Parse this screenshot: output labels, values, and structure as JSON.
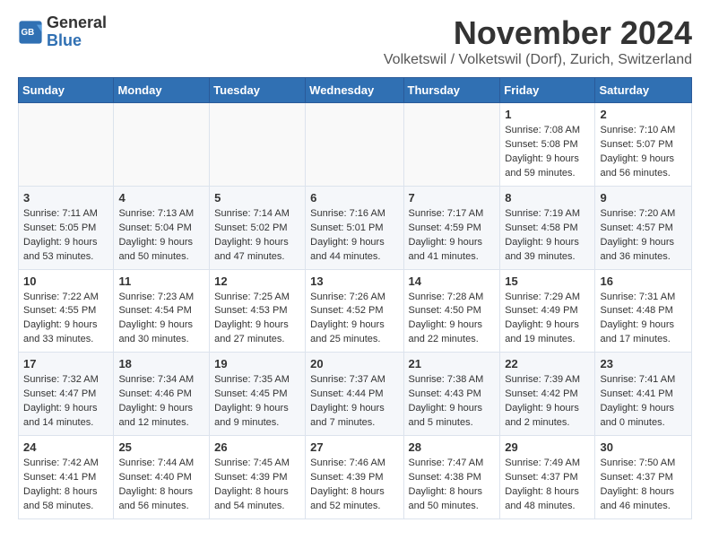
{
  "logo": {
    "line1": "General",
    "line2": "Blue"
  },
  "title": "November 2024",
  "subtitle": "Volketswil / Volketswil (Dorf), Zurich, Switzerland",
  "weekdays": [
    "Sunday",
    "Monday",
    "Tuesday",
    "Wednesday",
    "Thursday",
    "Friday",
    "Saturday"
  ],
  "weeks": [
    [
      {
        "day": "",
        "info": ""
      },
      {
        "day": "",
        "info": ""
      },
      {
        "day": "",
        "info": ""
      },
      {
        "day": "",
        "info": ""
      },
      {
        "day": "",
        "info": ""
      },
      {
        "day": "1",
        "info": "Sunrise: 7:08 AM\nSunset: 5:08 PM\nDaylight: 9 hours and 59 minutes."
      },
      {
        "day": "2",
        "info": "Sunrise: 7:10 AM\nSunset: 5:07 PM\nDaylight: 9 hours and 56 minutes."
      }
    ],
    [
      {
        "day": "3",
        "info": "Sunrise: 7:11 AM\nSunset: 5:05 PM\nDaylight: 9 hours and 53 minutes."
      },
      {
        "day": "4",
        "info": "Sunrise: 7:13 AM\nSunset: 5:04 PM\nDaylight: 9 hours and 50 minutes."
      },
      {
        "day": "5",
        "info": "Sunrise: 7:14 AM\nSunset: 5:02 PM\nDaylight: 9 hours and 47 minutes."
      },
      {
        "day": "6",
        "info": "Sunrise: 7:16 AM\nSunset: 5:01 PM\nDaylight: 9 hours and 44 minutes."
      },
      {
        "day": "7",
        "info": "Sunrise: 7:17 AM\nSunset: 4:59 PM\nDaylight: 9 hours and 41 minutes."
      },
      {
        "day": "8",
        "info": "Sunrise: 7:19 AM\nSunset: 4:58 PM\nDaylight: 9 hours and 39 minutes."
      },
      {
        "day": "9",
        "info": "Sunrise: 7:20 AM\nSunset: 4:57 PM\nDaylight: 9 hours and 36 minutes."
      }
    ],
    [
      {
        "day": "10",
        "info": "Sunrise: 7:22 AM\nSunset: 4:55 PM\nDaylight: 9 hours and 33 minutes."
      },
      {
        "day": "11",
        "info": "Sunrise: 7:23 AM\nSunset: 4:54 PM\nDaylight: 9 hours and 30 minutes."
      },
      {
        "day": "12",
        "info": "Sunrise: 7:25 AM\nSunset: 4:53 PM\nDaylight: 9 hours and 27 minutes."
      },
      {
        "day": "13",
        "info": "Sunrise: 7:26 AM\nSunset: 4:52 PM\nDaylight: 9 hours and 25 minutes."
      },
      {
        "day": "14",
        "info": "Sunrise: 7:28 AM\nSunset: 4:50 PM\nDaylight: 9 hours and 22 minutes."
      },
      {
        "day": "15",
        "info": "Sunrise: 7:29 AM\nSunset: 4:49 PM\nDaylight: 9 hours and 19 minutes."
      },
      {
        "day": "16",
        "info": "Sunrise: 7:31 AM\nSunset: 4:48 PM\nDaylight: 9 hours and 17 minutes."
      }
    ],
    [
      {
        "day": "17",
        "info": "Sunrise: 7:32 AM\nSunset: 4:47 PM\nDaylight: 9 hours and 14 minutes."
      },
      {
        "day": "18",
        "info": "Sunrise: 7:34 AM\nSunset: 4:46 PM\nDaylight: 9 hours and 12 minutes."
      },
      {
        "day": "19",
        "info": "Sunrise: 7:35 AM\nSunset: 4:45 PM\nDaylight: 9 hours and 9 minutes."
      },
      {
        "day": "20",
        "info": "Sunrise: 7:37 AM\nSunset: 4:44 PM\nDaylight: 9 hours and 7 minutes."
      },
      {
        "day": "21",
        "info": "Sunrise: 7:38 AM\nSunset: 4:43 PM\nDaylight: 9 hours and 5 minutes."
      },
      {
        "day": "22",
        "info": "Sunrise: 7:39 AM\nSunset: 4:42 PM\nDaylight: 9 hours and 2 minutes."
      },
      {
        "day": "23",
        "info": "Sunrise: 7:41 AM\nSunset: 4:41 PM\nDaylight: 9 hours and 0 minutes."
      }
    ],
    [
      {
        "day": "24",
        "info": "Sunrise: 7:42 AM\nSunset: 4:41 PM\nDaylight: 8 hours and 58 minutes."
      },
      {
        "day": "25",
        "info": "Sunrise: 7:44 AM\nSunset: 4:40 PM\nDaylight: 8 hours and 56 minutes."
      },
      {
        "day": "26",
        "info": "Sunrise: 7:45 AM\nSunset: 4:39 PM\nDaylight: 8 hours and 54 minutes."
      },
      {
        "day": "27",
        "info": "Sunrise: 7:46 AM\nSunset: 4:39 PM\nDaylight: 8 hours and 52 minutes."
      },
      {
        "day": "28",
        "info": "Sunrise: 7:47 AM\nSunset: 4:38 PM\nDaylight: 8 hours and 50 minutes."
      },
      {
        "day": "29",
        "info": "Sunrise: 7:49 AM\nSunset: 4:37 PM\nDaylight: 8 hours and 48 minutes."
      },
      {
        "day": "30",
        "info": "Sunrise: 7:50 AM\nSunset: 4:37 PM\nDaylight: 8 hours and 46 minutes."
      }
    ]
  ]
}
